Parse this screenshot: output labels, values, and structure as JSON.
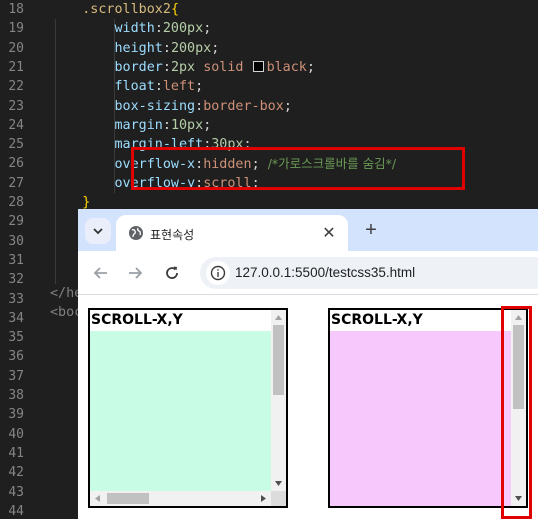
{
  "editor": {
    "line_numbers": [
      "18",
      "19",
      "20",
      "21",
      "22",
      "23",
      "24",
      "25",
      "26",
      "27",
      "28",
      "29",
      "30",
      "31",
      "32",
      "33",
      "34",
      "35",
      "36",
      "37",
      "38",
      "39",
      "40",
      "41",
      "42",
      "43",
      "44"
    ],
    "selector": ".scrollbox2",
    "open_brace": "{",
    "close_brace": "}",
    "decls": [
      {
        "prop": "width",
        "num": "200px",
        "val": ""
      },
      {
        "prop": "height",
        "num": "200px",
        "val": ""
      },
      {
        "prop": "border",
        "num": "2px",
        "val": "solid",
        "val2": "black"
      },
      {
        "prop": "float",
        "num": "",
        "val": "left"
      },
      {
        "prop": "box-sizing",
        "num": "",
        "val": "border-box"
      },
      {
        "prop": "margin",
        "num": "10px",
        "val": ""
      },
      {
        "prop": "margin-left",
        "num": "30px",
        "val": ""
      }
    ],
    "overflow_x": {
      "prop": "overflow-x",
      "val": "hidden",
      "comment": "/*가로스크롤바를 숨김*/"
    },
    "overflow_y": {
      "prop": "overflow-y",
      "val": "scroll"
    },
    "head_close_partial": "</he",
    "body_open_partial": "<boc"
  },
  "browser": {
    "tab_title": "표현속성",
    "url": "127.0.0.1:5500/testcss35.html",
    "boxes": [
      {
        "title": "SCROLL-X,Y",
        "fill": "#c8fce4"
      },
      {
        "title": "SCROLL-X,Y",
        "fill": "#f6c8fb"
      }
    ]
  },
  "colors": {
    "highlight": "#e00000",
    "tabstrip": "#d3e3fd"
  }
}
